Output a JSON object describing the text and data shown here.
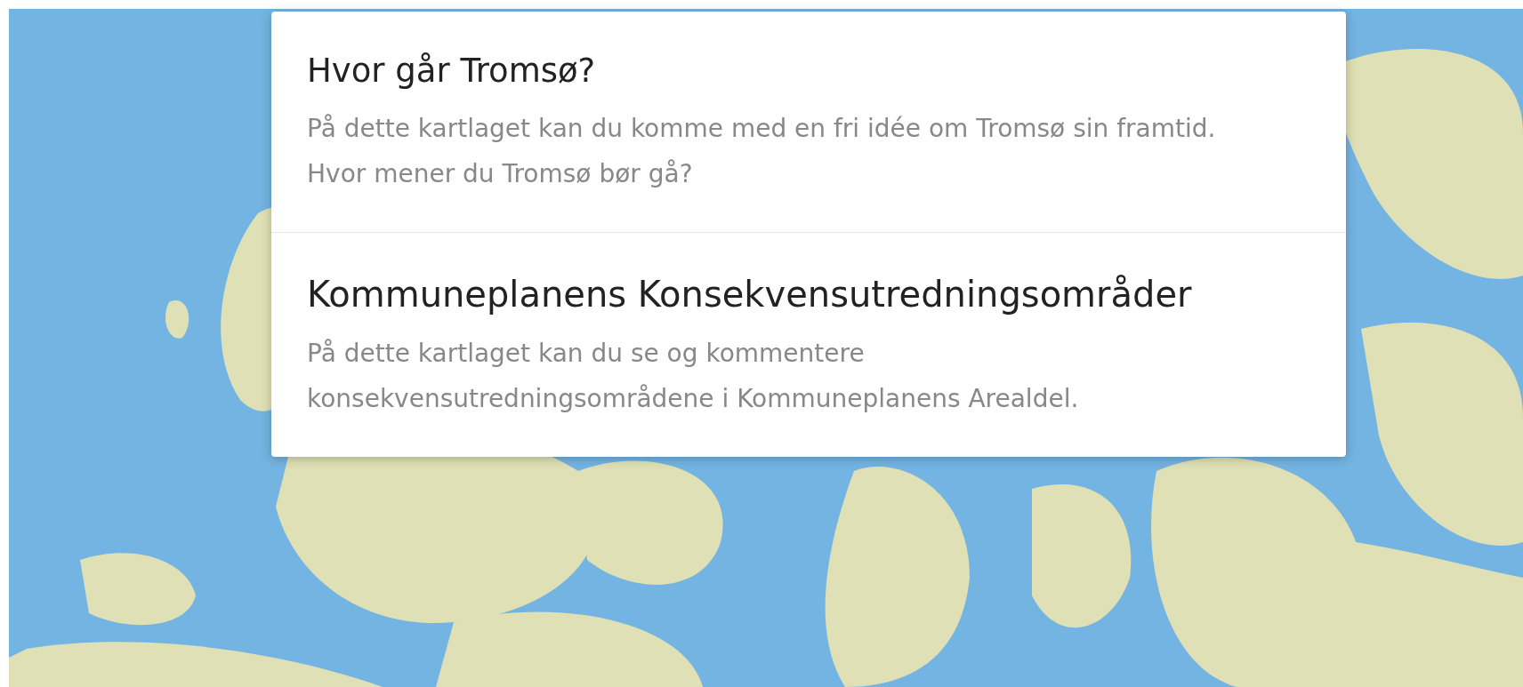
{
  "layers": [
    {
      "title": "Hvor går Tromsø?",
      "description": "På dette kartlaget kan du komme med en fri idée om Tromsø sin framtid. Hvor mener du Tromsø bør gå?"
    },
    {
      "title": "Kommuneplanens Konsekvensutredningsområder",
      "description": "På dette kartlaget kan du se og kommentere konsekvensutredningsområdene i Kommuneplanens Arealdel."
    }
  ]
}
